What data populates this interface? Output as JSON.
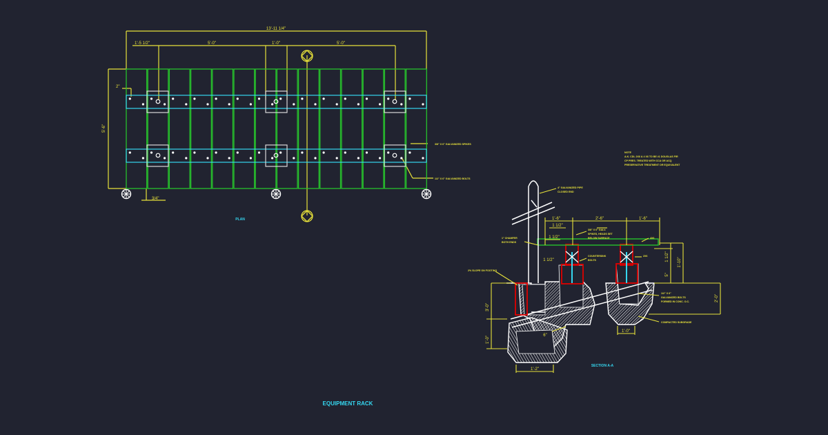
{
  "drawing_title": "EQUIPMENT RACK",
  "plan": {
    "label": "PLAN",
    "dims": {
      "overall_length": "13'-11 1/4\"",
      "left_offset": "1'-5 1/2\"",
      "span_1": "5'-0\"",
      "post_width": "1'-0\"",
      "span_2": "5'-0\"",
      "overall_width": "5'-6\"",
      "edge_offset": "2\"",
      "bottom_offset": "3/4\""
    },
    "callouts": {
      "spikes": "3/8\" X 6\" GALVANIZED SPIKES",
      "bolts": "1/2\" X 6\" GALVANIZED BOLTS"
    }
  },
  "section": {
    "label": "SECTION A-A",
    "note_lines": [
      "NOTE",
      "A.K. CDL 2X6 & 4 X6 TO BE #1 DOUGLAS FIR",
      "CP PRES. TREATED WITH CCA OR ACQ",
      "PRESERVATIVE TREATMENT OR EQUIVALENT"
    ],
    "callouts": {
      "pipe_1": "4\" GALVANIZED PIPE",
      "pipe_2": "CLOSED END",
      "chamfer_1": "1\" CHAMFER",
      "chamfer_2": "BOTH ENDS",
      "slope": "2% SLOPE ON FOOTING",
      "spikes_1": "3/8\" X 6\" GALV.",
      "spikes_2": "SPIKES, HEADS SET",
      "spikes_3": "BELOW SURFACE",
      "lumber_4x6": "4X6",
      "lumber_2x6": "2X6",
      "countersink_1": "COUNTERSINK",
      "countersink_2": "BOLTS",
      "galv_bolts_1": "1/2\" X 6\"",
      "galv_bolts_2": "GALVANIZED BOLTS",
      "galv_bolts_3": "FORMED IN CONC. O.C.",
      "subgrade": "COMPACTED SUBGRADE"
    },
    "dims": {
      "top_a": "1'-6\"",
      "top_b": "2'-6\"",
      "top_c": "1'-6\"",
      "half_a": "1 1/2\"",
      "half_b": "1 1/2\"",
      "half_c": "1 1/2\"",
      "small_a": "1 1/2\"",
      "left_a": "1 1/2\"",
      "right_a": "1 1/2\"",
      "right_b": "1'-10\"",
      "right_c": "2'-0\"",
      "mid_a": "5\"",
      "left_v1": "3'-0\"",
      "left_v2": "1'-0\"",
      "bottom_a": "1'-2\"",
      "bottom_b": "1'-0\"",
      "inner": "6\""
    }
  },
  "colors": {
    "background": "#212330",
    "dimension": "#e8e23a",
    "boards": "#27c22c",
    "bolt_lines": "#35d7f0",
    "plates": "#d9d9d9",
    "posts": "#e00000",
    "text_cyan": "#35d7f0"
  }
}
